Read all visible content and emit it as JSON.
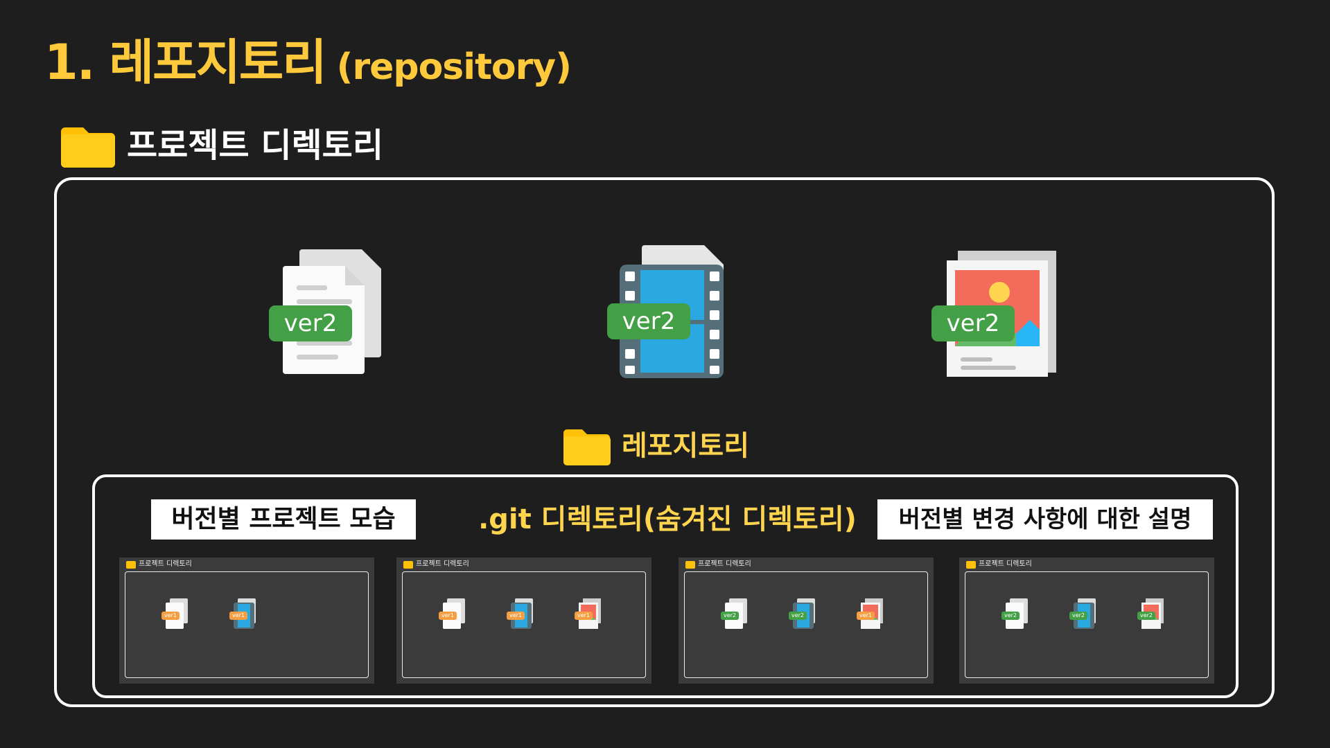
{
  "title": {
    "main": "1. 레포지토리",
    "sub": "(repository)"
  },
  "project_directory": {
    "label": "프로젝트 디렉토리",
    "icon": "folder-icon"
  },
  "files": [
    {
      "type": "document",
      "icon": "document-icon",
      "version": "ver2"
    },
    {
      "type": "video",
      "icon": "video-file-icon",
      "version": "ver2"
    },
    {
      "type": "image",
      "icon": "image-file-icon",
      "version": "ver2"
    }
  ],
  "repository": {
    "label": "레포지토리",
    "icon": "folder-icon"
  },
  "labels": {
    "projects_by_version": "버전별 프로젝트 모습",
    "git_directory": ".git 디렉토리(숨겨진 디렉토리)",
    "changes_by_version": "버전별 변경 사항에 대한 설명"
  },
  "snapshots": [
    {
      "label": "프로젝트 디렉토리",
      "files": [
        {
          "type": "document",
          "version": "ver1"
        },
        {
          "type": "video",
          "version": "ver1"
        }
      ]
    },
    {
      "label": "프로젝트 디렉토리",
      "files": [
        {
          "type": "document",
          "version": "ver1"
        },
        {
          "type": "video",
          "version": "ver1"
        },
        {
          "type": "image",
          "version": "ver1"
        }
      ]
    },
    {
      "label": "프로젝트 디렉토리",
      "files": [
        {
          "type": "document",
          "version": "ver2"
        },
        {
          "type": "video",
          "version": "ver2"
        },
        {
          "type": "image",
          "version": "ver1"
        }
      ]
    },
    {
      "label": "프로젝트 디렉토리",
      "files": [
        {
          "type": "document",
          "version": "ver2"
        },
        {
          "type": "video",
          "version": "ver2"
        },
        {
          "type": "image",
          "version": "ver2"
        }
      ]
    }
  ],
  "colors": {
    "background": "#1e1e1e",
    "title": "#ffc93c",
    "folder": "#ffc107",
    "ver1": "#f59e42",
    "ver2": "#43a047"
  }
}
